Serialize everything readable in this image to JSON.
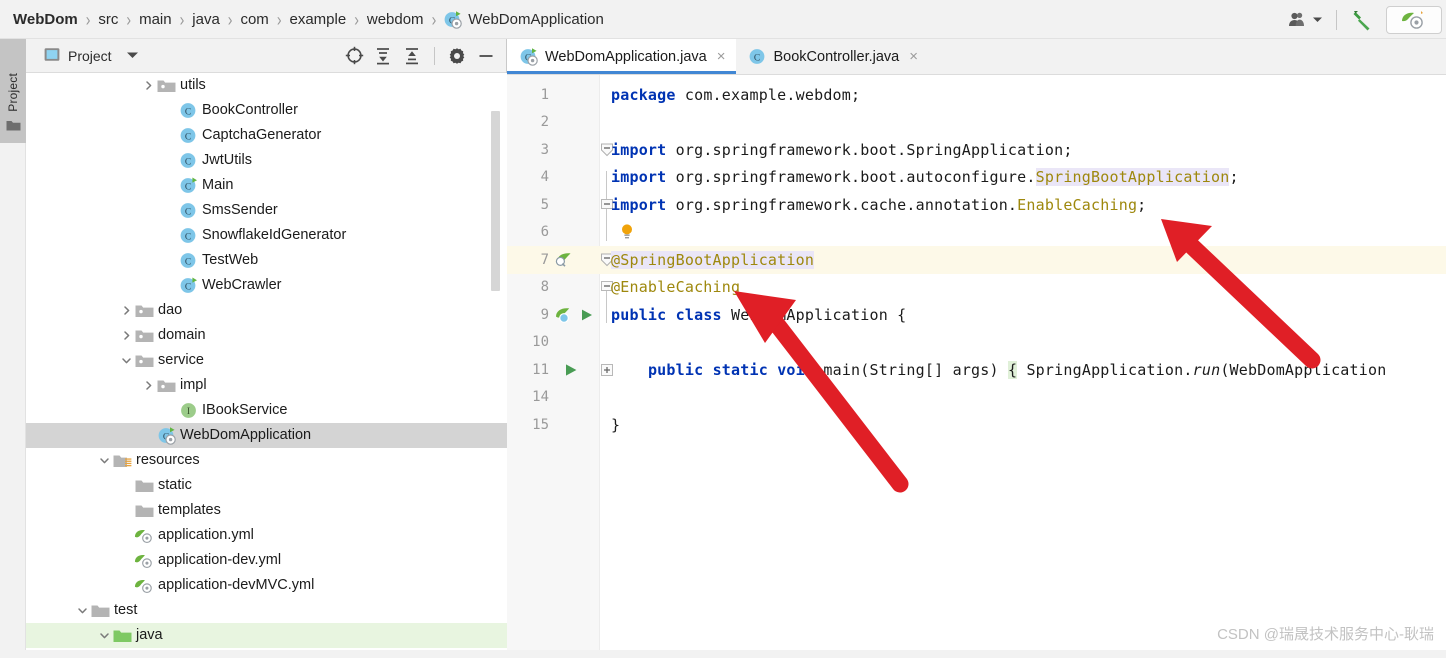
{
  "window": {
    "breadcrumb": [
      {
        "label": "WebDom",
        "bold": true,
        "icon": ""
      },
      {
        "label": "src",
        "bold": false,
        "icon": ""
      },
      {
        "label": "main",
        "bold": false,
        "icon": ""
      },
      {
        "label": "java",
        "bold": false,
        "icon": ""
      },
      {
        "label": "com",
        "bold": false,
        "icon": ""
      },
      {
        "label": "example",
        "bold": false,
        "icon": ""
      },
      {
        "label": "webdom",
        "bold": false,
        "icon": ""
      },
      {
        "label": "WebDomApplication",
        "bold": false,
        "icon": "spring-boot-class-icon"
      }
    ],
    "separator": "›"
  },
  "toolbar_right": {
    "user_icon": "user-account-icon",
    "user_dropdown": "▾",
    "build_icon": "hammer-build-icon",
    "run_coverage_icon": "spring-run-icon"
  },
  "tool_stripe": {
    "project_tab_label": "Project",
    "project_tab_icon": "folder-icon"
  },
  "project_panel": {
    "title": "Project",
    "panel_icon": "project-view-icon",
    "caret_icon": "chevron-down-icon",
    "actions": [
      {
        "name": "scroll-from-source-icon",
        "glyph": "target-icon"
      },
      {
        "name": "expand-all-icon",
        "glyph": "expand-all-icon"
      },
      {
        "name": "collapse-all-icon",
        "glyph": "collapse-all-icon"
      },
      {
        "name": "settings-gear-icon",
        "glyph": "gear-icon"
      },
      {
        "name": "hide-panel-icon",
        "glyph": "minus-icon"
      }
    ],
    "tree": [
      {
        "label": "utils",
        "indent": 5,
        "arrow": "right",
        "icon": "package-folder-icon",
        "state": "normal"
      },
      {
        "label": "BookController",
        "indent": 6,
        "arrow": "none",
        "icon": "class-icon",
        "state": "normal"
      },
      {
        "label": "CaptchaGenerator",
        "indent": 6,
        "arrow": "none",
        "icon": "class-icon",
        "state": "normal"
      },
      {
        "label": "JwtUtils",
        "indent": 6,
        "arrow": "none",
        "icon": "class-icon",
        "state": "normal"
      },
      {
        "label": "Main",
        "indent": 6,
        "arrow": "none",
        "icon": "runnable-class-icon",
        "state": "normal"
      },
      {
        "label": "SmsSender",
        "indent": 6,
        "arrow": "none",
        "icon": "class-icon",
        "state": "normal"
      },
      {
        "label": "SnowflakeIdGenerator",
        "indent": 6,
        "arrow": "none",
        "icon": "class-icon",
        "state": "normal"
      },
      {
        "label": "TestWeb",
        "indent": 6,
        "arrow": "none",
        "icon": "class-icon",
        "state": "normal"
      },
      {
        "label": "WebCrawler",
        "indent": 6,
        "arrow": "none",
        "icon": "runnable-class-icon",
        "state": "normal"
      },
      {
        "label": "dao",
        "indent": 4,
        "arrow": "right",
        "icon": "package-folder-icon",
        "state": "normal"
      },
      {
        "label": "domain",
        "indent": 4,
        "arrow": "right",
        "icon": "package-folder-icon",
        "state": "normal"
      },
      {
        "label": "service",
        "indent": 4,
        "arrow": "down",
        "icon": "package-folder-icon",
        "state": "normal"
      },
      {
        "label": "impl",
        "indent": 5,
        "arrow": "right",
        "icon": "package-folder-icon",
        "state": "normal"
      },
      {
        "label": "IBookService",
        "indent": 6,
        "arrow": "none",
        "icon": "interface-icon",
        "state": "normal"
      },
      {
        "label": "WebDomApplication",
        "indent": 5,
        "arrow": "none",
        "icon": "spring-boot-class-icon",
        "state": "selected"
      },
      {
        "label": "resources",
        "indent": 3,
        "arrow": "down",
        "icon": "resources-folder-icon",
        "state": "normal"
      },
      {
        "label": "static",
        "indent": 4,
        "arrow": "none",
        "icon": "folder-icon",
        "state": "normal"
      },
      {
        "label": "templates",
        "indent": 4,
        "arrow": "none",
        "icon": "folder-icon",
        "state": "normal"
      },
      {
        "label": "application.yml",
        "indent": 4,
        "arrow": "none",
        "icon": "spring-yaml-icon",
        "state": "normal"
      },
      {
        "label": "application-dev.yml",
        "indent": 4,
        "arrow": "none",
        "icon": "spring-yaml-icon",
        "state": "normal"
      },
      {
        "label": "application-devMVC.yml",
        "indent": 4,
        "arrow": "none",
        "icon": "spring-yaml-icon",
        "state": "normal"
      },
      {
        "label": "test",
        "indent": 2,
        "arrow": "down",
        "icon": "folder-icon",
        "state": "normal"
      },
      {
        "label": "java",
        "indent": 3,
        "arrow": "down",
        "icon": "test-source-folder-icon",
        "state": "green"
      }
    ]
  },
  "editor": {
    "tabs": [
      {
        "label": "WebDomApplication.java",
        "icon": "spring-boot-class-icon",
        "active": true,
        "close": "×"
      },
      {
        "label": "BookController.java",
        "icon": "class-icon",
        "active": false,
        "close": "×"
      }
    ],
    "lines": [
      {
        "num": "1",
        "caret": false,
        "fold": "none",
        "gutter": "none",
        "segments": [
          {
            "t": "package ",
            "c": "kw"
          },
          {
            "t": "com.example.webdom;",
            "c": ""
          }
        ]
      },
      {
        "num": "2",
        "caret": false,
        "fold": "none",
        "gutter": "none",
        "segments": []
      },
      {
        "num": "3",
        "caret": false,
        "fold": "collapse",
        "gutter": "none",
        "segments": [
          {
            "t": "import",
            "c": "kw"
          },
          {
            "t": " org.springframework.boot.SpringApplication;",
            "c": ""
          }
        ]
      },
      {
        "num": "4",
        "caret": false,
        "fold": "none",
        "gutter": "none",
        "segments": [
          {
            "t": "import",
            "c": "kw"
          },
          {
            "t": " org.springframework.boot.autoconfigure.",
            "c": ""
          },
          {
            "t": "SpringBootApplication",
            "c": "ann hl-ident"
          },
          {
            "t": ";",
            "c": ""
          }
        ]
      },
      {
        "num": "5",
        "caret": false,
        "fold": "end",
        "gutter": "none",
        "segments": [
          {
            "t": "import",
            "c": "kw"
          },
          {
            "t": " org.springframework.cache.annotation.",
            "c": ""
          },
          {
            "t": "EnableCaching",
            "c": "ann"
          },
          {
            "t": ";",
            "c": ""
          }
        ]
      },
      {
        "num": "6",
        "caret": false,
        "fold": "none",
        "gutter": "lightbulb",
        "segments": []
      },
      {
        "num": "7",
        "caret": true,
        "fold": "collapse",
        "gutter": "spring-bean",
        "segments": [
          {
            "t": "@SpringBootApplication",
            "c": "ann hl-ident"
          }
        ]
      },
      {
        "num": "8",
        "caret": false,
        "fold": "end",
        "gutter": "none",
        "segments": [
          {
            "t": "@EnableCaching",
            "c": "ann"
          }
        ]
      },
      {
        "num": "9",
        "caret": false,
        "fold": "none",
        "gutter": "spring-run",
        "segments": [
          {
            "t": "public",
            "c": "kw"
          },
          {
            "t": " ",
            "c": ""
          },
          {
            "t": "class",
            "c": "kw"
          },
          {
            "t": " WebDomApplication {",
            "c": ""
          }
        ]
      },
      {
        "num": "10",
        "caret": false,
        "fold": "none",
        "gutter": "none",
        "segments": []
      },
      {
        "num": "11",
        "caret": false,
        "fold": "expand",
        "gutter": "run",
        "segments": [
          {
            "t": "    ",
            "c": ""
          },
          {
            "t": "public",
            "c": "kw"
          },
          {
            "t": " ",
            "c": ""
          },
          {
            "t": "static",
            "c": "kw"
          },
          {
            "t": " ",
            "c": ""
          },
          {
            "t": "void",
            "c": "kw"
          },
          {
            "t": " main(String[] args) ",
            "c": ""
          },
          {
            "t": "{",
            "c": "hl-brace"
          },
          {
            "t": " SpringApplication.",
            "c": ""
          },
          {
            "t": "run",
            "c": "ital"
          },
          {
            "t": "(WebDomApplication",
            "c": ""
          }
        ]
      },
      {
        "num": "14",
        "caret": false,
        "fold": "none",
        "gutter": "none",
        "segments": []
      },
      {
        "num": "15",
        "caret": false,
        "fold": "none",
        "gutter": "none",
        "segments": [
          {
            "t": "}",
            "c": ""
          }
        ]
      }
    ]
  },
  "watermark": {
    "text": "CSDN @瑞晟技术服务中心-耿瑞"
  },
  "annotations": {
    "arrow_color": "#e01f26",
    "arrows": [
      {
        "name": "arrow-pointing-to-enable-caching-import"
      },
      {
        "name": "arrow-pointing-to-class-declaration"
      }
    ]
  }
}
